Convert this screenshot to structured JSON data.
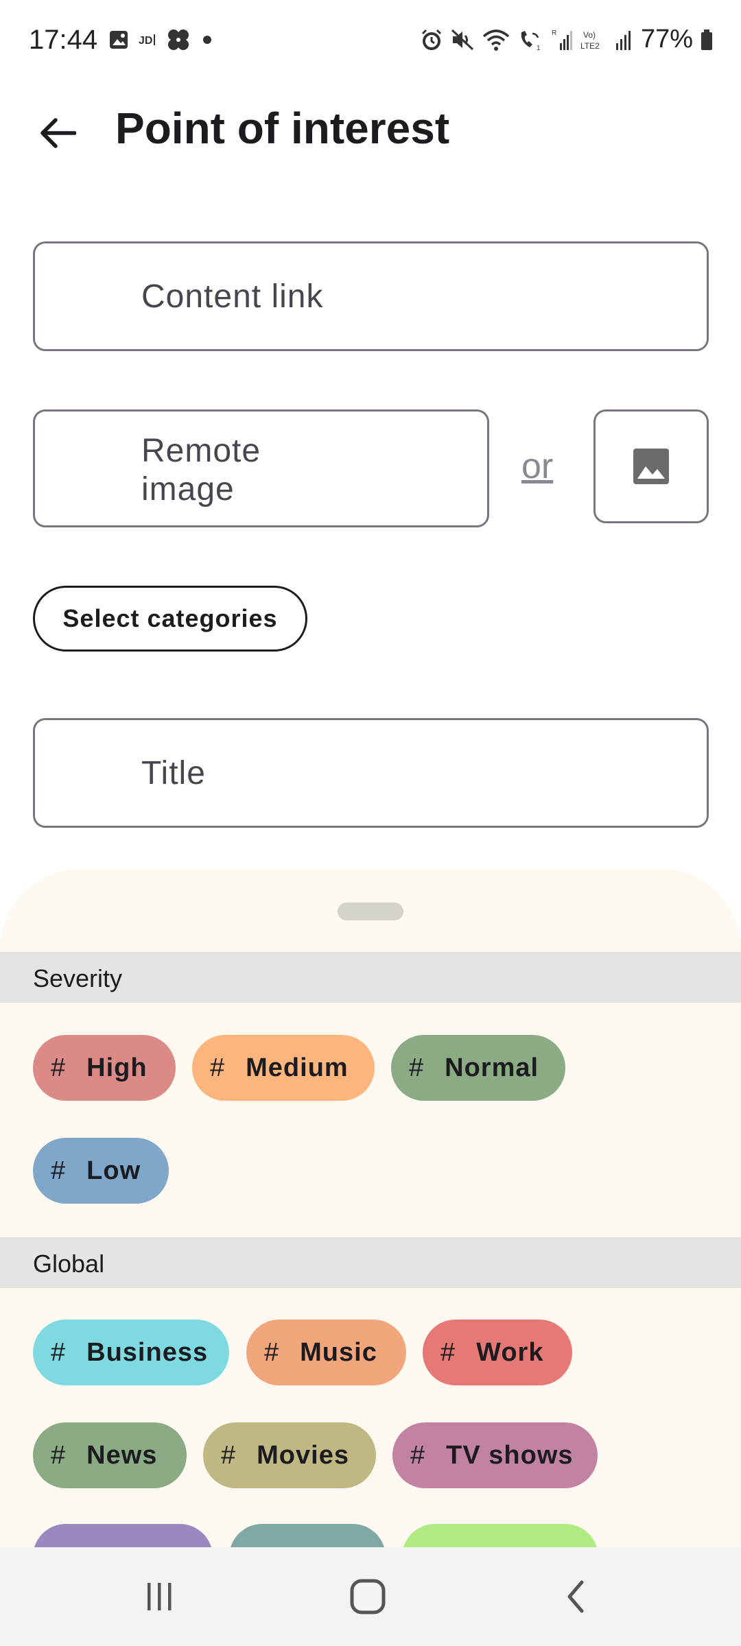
{
  "status_bar": {
    "time": "17:44",
    "battery": "77%",
    "left_icons": [
      "gallery-icon",
      "jd-icon",
      "pinwheel-icon",
      "dot-icon"
    ],
    "right_icons": [
      "alarm-icon",
      "mute-icon",
      "wifi-icon",
      "wifi-calling-icon",
      "signal-icon",
      "volte-icon",
      "signal-icon",
      "battery-icon"
    ]
  },
  "app_bar": {
    "title": "Point of interest",
    "back_icon": "arrow-back-icon"
  },
  "form": {
    "content_link_placeholder": "Content link",
    "remote_image_placeholder": "Remote\nimage",
    "or_label": "or",
    "image_picker_icon": "image-icon",
    "select_categories_label": "Select categories",
    "title_placeholder": "Title"
  },
  "sheet": {
    "sections": [
      {
        "name": "Severity",
        "chips": [
          {
            "label": "High",
            "color": "#db8a86"
          },
          {
            "label": "Medium",
            "color": "#fcb57c"
          },
          {
            "label": "Normal",
            "color": "#8aab84"
          },
          {
            "label": "Low",
            "color": "#7fa7c9"
          }
        ]
      },
      {
        "name": "Global",
        "chips": [
          {
            "label": "Business",
            "color": "#7ed9e0"
          },
          {
            "label": "Music",
            "color": "#f0a57b"
          },
          {
            "label": "Work",
            "color": "#e67876"
          },
          {
            "label": "News",
            "color": "#8aab84"
          },
          {
            "label": "Movies",
            "color": "#c0b882"
          },
          {
            "label": "TV shows",
            "color": "#c283a3"
          },
          {
            "label": "",
            "color": "#9a88c0"
          },
          {
            "label": "",
            "color": "#7fa8a5"
          },
          {
            "label": "",
            "color": "#b0ea83"
          }
        ]
      }
    ],
    "hash_symbol": "#"
  },
  "nav_bar": {
    "icons": [
      "recents-icon",
      "home-icon",
      "back-icon"
    ]
  }
}
